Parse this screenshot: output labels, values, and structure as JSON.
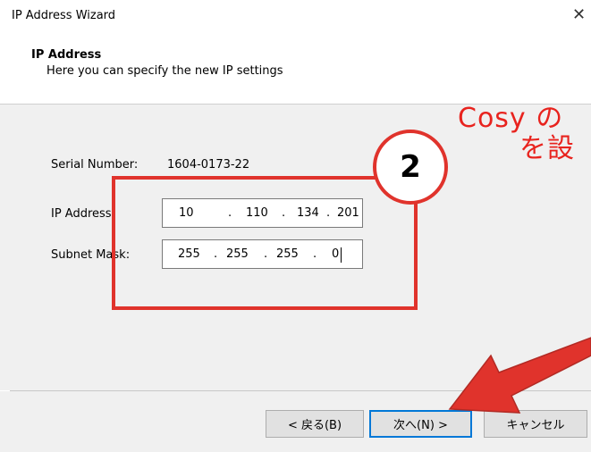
{
  "window": {
    "title": "IP Address Wizard"
  },
  "header": {
    "title": "IP Address",
    "subtitle": "Here you can specify the new IP settings"
  },
  "form": {
    "serial_label": "Serial Number:",
    "serial_value": "1604-0173-22",
    "ip_label": "IP Address:",
    "ip_octets": [
      "10",
      "110",
      "134",
      "201"
    ],
    "mask_label": "Subnet Mask:",
    "mask_octets": [
      "255",
      "255",
      "255",
      "0"
    ],
    "dot": "."
  },
  "buttons": {
    "back": "< 戻る(B)",
    "next": "次へ(N) >",
    "cancel": "キャンセル"
  },
  "annotation": {
    "step_number": "2",
    "line1": "Cosy の",
    "line2": "を設",
    "color": "#e0332c"
  },
  "icons": {
    "close": "close-icon"
  }
}
